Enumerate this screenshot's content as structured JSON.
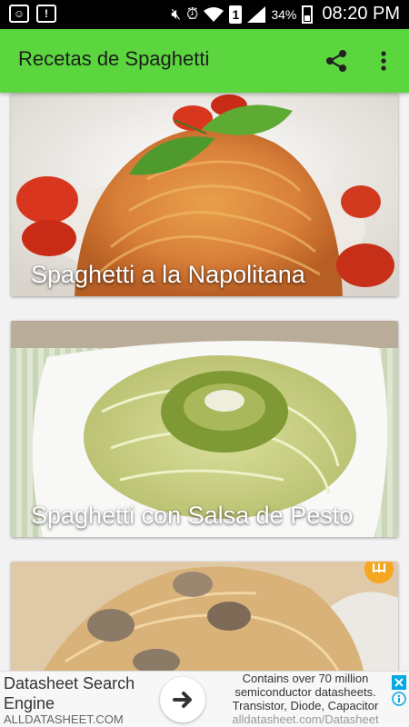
{
  "status_bar": {
    "time": "08:20 PM",
    "battery": "34%",
    "sim": "1",
    "icons": [
      "smiley-notification-icon",
      "alert-notification-icon",
      "mute-icon",
      "alarm-icon",
      "wifi-icon",
      "sim-icon",
      "signal-icon",
      "battery-icon"
    ]
  },
  "app_bar": {
    "title": "Recetas de Spaghetti",
    "icons": [
      "share-icon",
      "more-vert-icon"
    ],
    "color": "#5bd63e"
  },
  "recipes": [
    {
      "title": "Spaghetti a la Napolitana"
    },
    {
      "title": "Spaghetti con Salsa de Pesto"
    },
    {
      "title": ""
    }
  ],
  "ad": {
    "headline": "Datasheet Search Engine",
    "url": "ALLDATASHEET.COM",
    "description": "Contains over 70 million semiconductor datasheets. Transistor, Diode, Capacitor",
    "description_url": "alldatasheet.com/Datasheet",
    "icons": [
      "arrow-right-icon",
      "close-icon",
      "info-icon"
    ],
    "accent": "#1a73e8"
  }
}
